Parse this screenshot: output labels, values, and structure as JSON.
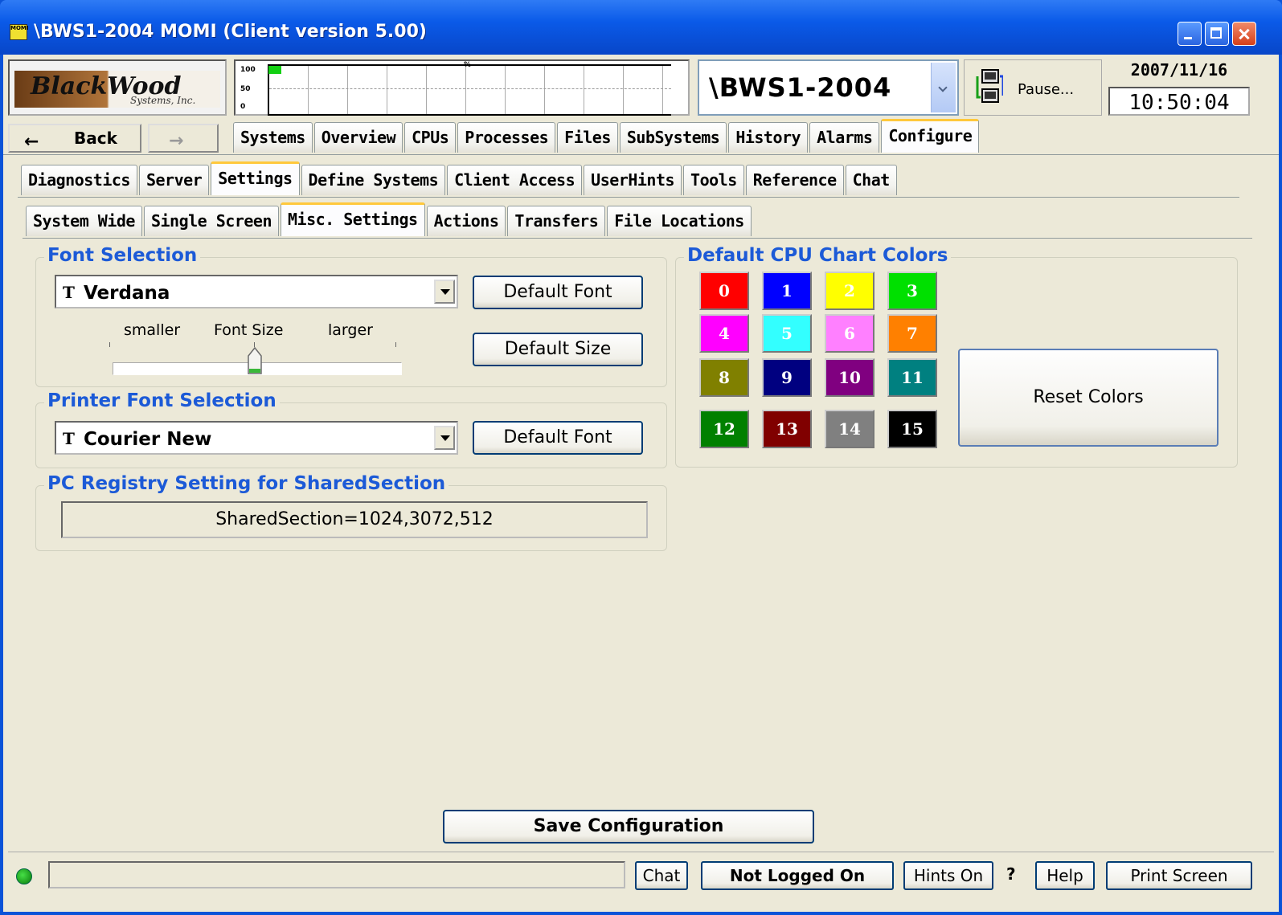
{
  "window": {
    "title": "\\BWS1-2004 MOMI (Client version 5.00)",
    "icon_text": "MOMI"
  },
  "header": {
    "logo_line1": "BlackWood",
    "logo_line2": "Systems, Inc.",
    "graph_ticks": [
      "100",
      "50",
      "0"
    ],
    "graph_pct_label": "%",
    "system_name": "\\BWS1-2004",
    "pause_label": "Pause...",
    "date": "2007/11/16",
    "time": "10:50:04"
  },
  "nav": {
    "back_label": "Back"
  },
  "main_tabs": [
    {
      "label": "Systems"
    },
    {
      "label": "Overview"
    },
    {
      "label": "CPUs"
    },
    {
      "label": "Processes"
    },
    {
      "label": "Files"
    },
    {
      "label": "SubSystems"
    },
    {
      "label": "History"
    },
    {
      "label": "Alarms"
    },
    {
      "label": "Configure",
      "active": true
    }
  ],
  "sub_tabs": [
    {
      "label": "Diagnostics"
    },
    {
      "label": "Server"
    },
    {
      "label": "Settings",
      "active": true
    },
    {
      "label": "Define Systems"
    },
    {
      "label": "Client Access"
    },
    {
      "label": "UserHints"
    },
    {
      "label": "Tools"
    },
    {
      "label": "Reference"
    },
    {
      "label": "Chat"
    }
  ],
  "settings_tabs": [
    {
      "label": "System Wide"
    },
    {
      "label": "Single Screen"
    },
    {
      "label": "Misc. Settings",
      "active": true
    },
    {
      "label": "Actions"
    },
    {
      "label": "Transfers"
    },
    {
      "label": "File Locations"
    }
  ],
  "font_selection": {
    "title": "Font Selection",
    "font_value": "Verdana",
    "default_font_label": "Default Font",
    "default_size_label": "Default Size",
    "smaller_label": "smaller",
    "font_size_label": "Font Size",
    "larger_label": "larger",
    "font_size_position": 0.5
  },
  "printer_font": {
    "title": "Printer Font Selection",
    "font_value": "Courier New",
    "default_font_label": "Default Font"
  },
  "registry": {
    "title": "PC Registry Setting for SharedSection",
    "value": "SharedSection=1024,3072,512"
  },
  "cpu_colors": {
    "title": "Default CPU Chart Colors",
    "reset_label": "Reset Colors",
    "swatches": [
      {
        "label": "0",
        "color": "#ff0000",
        "text": "#ffffff"
      },
      {
        "label": "1",
        "color": "#0000ff",
        "text": "#ffffff"
      },
      {
        "label": "2",
        "color": "#ffff00",
        "text": "#ffffff"
      },
      {
        "label": "3",
        "color": "#00e000",
        "text": "#ffffff"
      },
      {
        "label": "4",
        "color": "#ff00ff",
        "text": "#ffffff"
      },
      {
        "label": "5",
        "color": "#33ffff",
        "text": "#ffffff"
      },
      {
        "label": "6",
        "color": "#ff80ff",
        "text": "#ffffff"
      },
      {
        "label": "7",
        "color": "#ff8000",
        "text": "#ffffff"
      },
      {
        "label": "8",
        "color": "#808000",
        "text": "#ffffff"
      },
      {
        "label": "9",
        "color": "#000080",
        "text": "#ffffff"
      },
      {
        "label": "10",
        "color": "#800080",
        "text": "#ffffff"
      },
      {
        "label": "11",
        "color": "#008080",
        "text": "#ffffff"
      },
      {
        "label": "12",
        "color": "#008000",
        "text": "#ffffff"
      },
      {
        "label": "13",
        "color": "#800000",
        "text": "#ffffff"
      },
      {
        "label": "14",
        "color": "#808080",
        "text": "#ffffff"
      },
      {
        "label": "15",
        "color": "#000000",
        "text": "#ffffff"
      }
    ]
  },
  "footer": {
    "save_label": "Save Configuration"
  },
  "statusbar": {
    "status_text": "",
    "chat_label": "Chat",
    "login_label": "Not Logged On",
    "hints_label": "Hints On",
    "question_label": "?",
    "help_label": "Help",
    "print_label": "Print Screen"
  }
}
